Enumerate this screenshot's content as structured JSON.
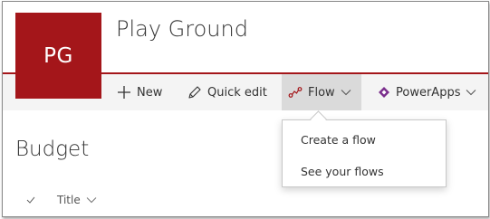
{
  "site": {
    "logo_text": "PG",
    "title": "Play Ground",
    "accent_color": "#a4161a"
  },
  "commandbar": {
    "new_label": "New",
    "quick_edit_label": "Quick edit",
    "flow_label": "Flow",
    "powerapps_label": "PowerApps"
  },
  "flow_menu": {
    "items": [
      "Create a flow",
      "See your flows"
    ]
  },
  "page": {
    "title": "Budget"
  },
  "list": {
    "column_title": "Title"
  }
}
